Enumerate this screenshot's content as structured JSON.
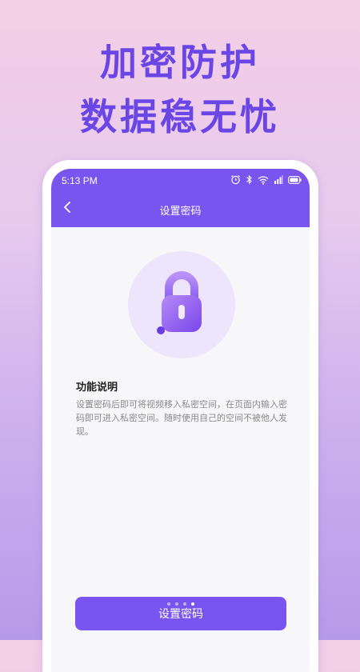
{
  "promo": {
    "line1": "加密防护",
    "line2": "数据稳无忧"
  },
  "status_bar": {
    "time": "5:13 PM",
    "icons": [
      "alarm-icon",
      "bluetooth-icon",
      "wifi-icon",
      "signal-icon",
      "battery-icon"
    ]
  },
  "app_bar": {
    "title": "设置密码",
    "back_icon": "chevron-left-icon",
    "color": "#7a54ef"
  },
  "hero": {
    "icon": "lock-icon"
  },
  "feature": {
    "title": "功能说明",
    "description": "设置密码后即可将视频移入私密空间，在页面内输入密码即可进入私密空间。随时使用自己的空间不被他人发现。"
  },
  "pager": {
    "count": 4,
    "active_index": 3
  },
  "action": {
    "label": "设置密码"
  },
  "colors": {
    "accent": "#7a54ef",
    "headline": "#6a46e6"
  }
}
